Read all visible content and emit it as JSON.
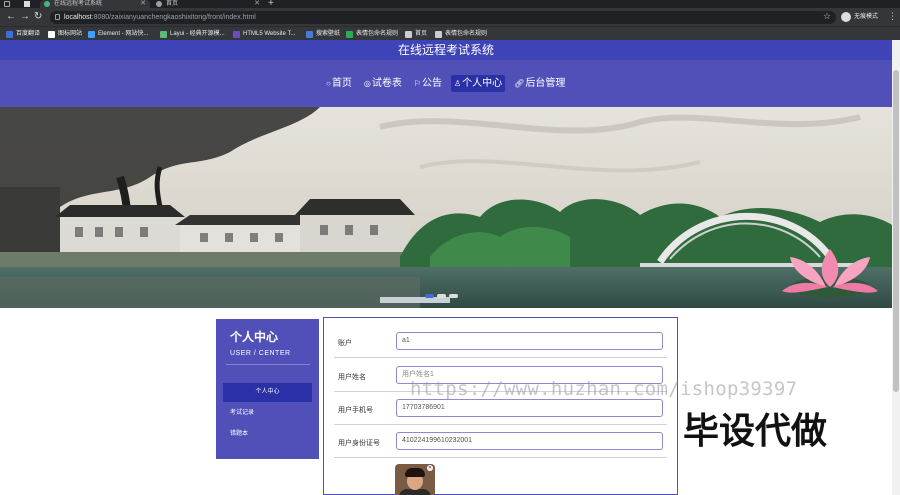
{
  "browser": {
    "tabs": [
      {
        "label": "在线远程考试系统"
      },
      {
        "label": "首页"
      }
    ],
    "new_tab": "+",
    "url_host": "localhost",
    "url_path": ":8080/zaixianyuanchengkaoshixitong/front/index.html",
    "profile_label": "无痕模式",
    "bookmarks": [
      {
        "label": "百度翻译",
        "color": "#3b6fd8"
      },
      {
        "label": "图标网站",
        "color": "#ffffff"
      },
      {
        "label": "Element - 网站快...",
        "color": "#409eff"
      },
      {
        "label": "Layui - 经典开源模...",
        "color": "#5fb878"
      },
      {
        "label": "HTML5 Website T...",
        "color": "#6a4bc4"
      },
      {
        "label": "搜索壁纸",
        "color": "#4a7ad8"
      },
      {
        "label": "表情包命名规则",
        "color": "#2eaa55"
      },
      {
        "label": "首页",
        "color": "#cccccc"
      },
      {
        "label": "表情包命名规则",
        "color": "#cccccc"
      }
    ]
  },
  "header": {
    "site_title": "在线远程考试系统",
    "nav": [
      {
        "icon": "○",
        "label": "首页",
        "active": false
      },
      {
        "icon": "◎",
        "label": "试卷表",
        "active": false
      },
      {
        "icon": "⚐",
        "label": "公告",
        "active": false
      },
      {
        "icon": "♙",
        "label": "个人中心",
        "active": true
      },
      {
        "icon": "🔗",
        "label": "后台管理",
        "active": false
      }
    ]
  },
  "sidebar": {
    "title": "个人中心",
    "subtitle": "USER / CENTER",
    "items": [
      {
        "label": "个人中心",
        "active": true
      },
      {
        "label": "考试记录",
        "active": false
      },
      {
        "label": "错题本",
        "active": false
      }
    ]
  },
  "form": {
    "fields": [
      {
        "label": "账户",
        "value": "a1",
        "is_placeholder": false
      },
      {
        "label": "用户姓名",
        "value": "用户姓名1",
        "is_placeholder": true
      },
      {
        "label": "用户手机号",
        "value": "17703786901",
        "is_placeholder": false
      },
      {
        "label": "用户身份证号",
        "value": "410224199610232001",
        "is_placeholder": false
      }
    ]
  },
  "watermark": {
    "url": "https://www.huzhan.com/ishop39397",
    "text": "毕设代做"
  },
  "colors": {
    "brand": "#5050b8",
    "brand_dark": "#2a30a6",
    "title_bar": "#3e44b8"
  }
}
